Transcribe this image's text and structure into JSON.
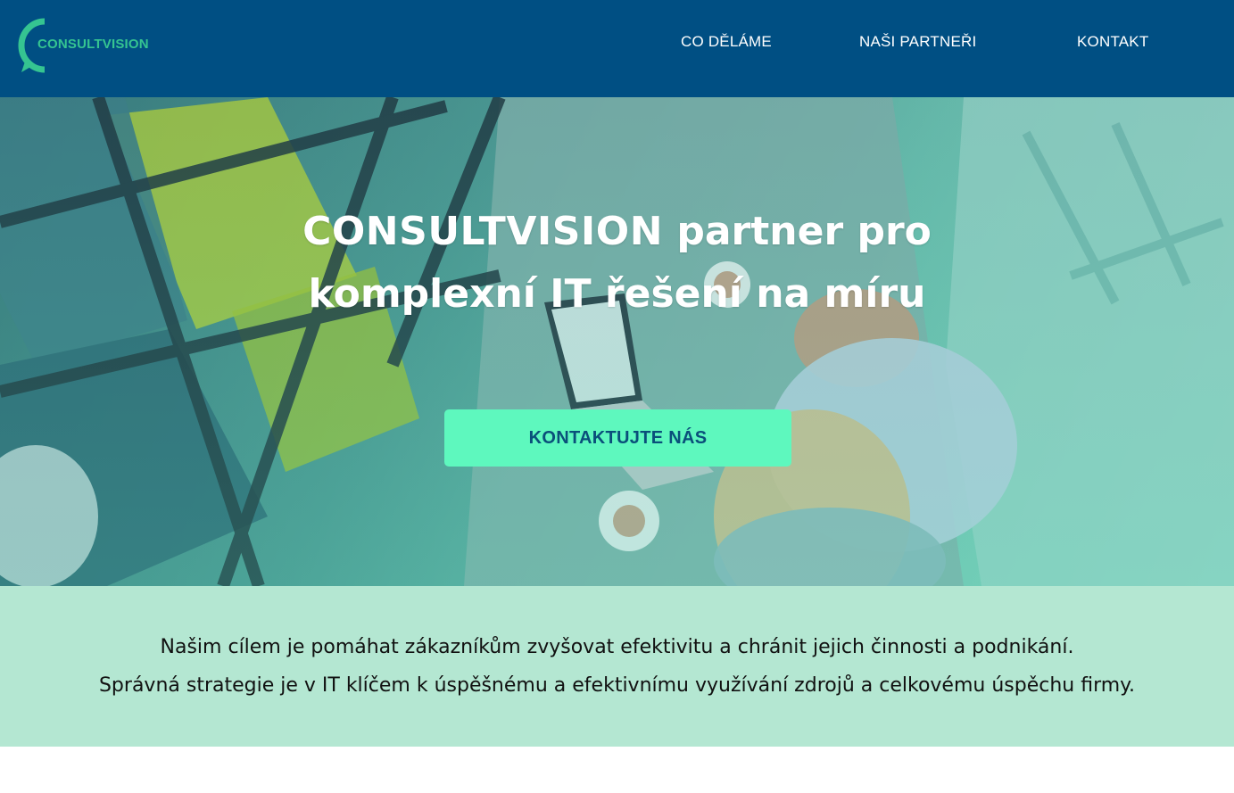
{
  "brand": {
    "logo_text": "CONSULTVISION",
    "colors": {
      "header_bg": "#004f83",
      "logo_green": "#35c491",
      "cta_bg": "#5ef8be",
      "cta_text": "#0a4f7a",
      "band_bg": "#b4e7d2"
    }
  },
  "nav": {
    "items": [
      {
        "label": "CO DĚLÁME"
      },
      {
        "label": "NAŠI PARTNEŘI"
      },
      {
        "label": "KONTAKT"
      }
    ]
  },
  "hero": {
    "title_brand": "CONSULTVISION",
    "title_rest": "partner pro",
    "title_line2": "komplexní IT řešení na míru",
    "cta_label": "KONTAKTUJTE NÁS",
    "background_image": "office-meeting-photo"
  },
  "mission": {
    "line1": "Našim cílem je pomáhat zákazníkům zvyšovat efektivitu a chránit jejich činnosti a podnikání.",
    "line2": "Správná strategie je v IT klíčem k úspěšnému a efektivnímu využívání zdrojů a celkovému úspěchu firmy."
  }
}
